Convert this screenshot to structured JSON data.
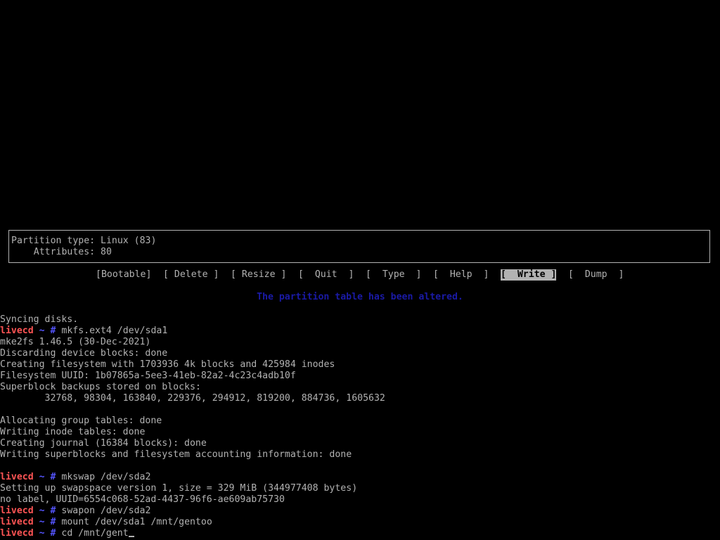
{
  "info": {
    "partition_type": "Partition type: Linux (83)",
    "attributes": "    Attributes: 80"
  },
  "menu": {
    "bootable": "[Bootable]",
    "delete": "[ Delete ]",
    "resize": "[ Resize ]",
    "quit": "[  Quit  ]",
    "type": "[  Type  ]",
    "help": "[  Help  ]",
    "write": "[  Write ]",
    "dump": "[  Dump  ]",
    "selected": "write"
  },
  "status_message": "The partition table has been altered.",
  "prompt": {
    "host": "livecd",
    "path": "~",
    "symbol": "#"
  },
  "terminal": {
    "line_00": "Syncing disks.",
    "cmd_01": "mkfs.ext4 /dev/sda1",
    "line_02": "mke2fs 1.46.5 (30-Dec-2021)",
    "line_03": "Discarding device blocks: done",
    "line_04": "Creating filesystem with 1703936 4k blocks and 425984 inodes",
    "line_05": "Filesystem UUID: 1b07865a-5ee3-41eb-82a2-4c23c4adb10f",
    "line_06": "Superblock backups stored on blocks:",
    "line_07": "        32768, 98304, 163840, 229376, 294912, 819200, 884736, 1605632",
    "line_09": "Allocating group tables: done",
    "line_10": "Writing inode tables: done",
    "line_11": "Creating journal (16384 blocks): done",
    "line_12": "Writing superblocks and filesystem accounting information: done",
    "cmd_14": "mkswap /dev/sda2",
    "line_15": "Setting up swapspace version 1, size = 329 MiB (344977408 bytes)",
    "line_16": "no label, UUID=6554c068-52ad-4437-96f6-ae609ab75730",
    "cmd_17": "swapon /dev/sda2",
    "cmd_18": "mount /dev/sda1 /mnt/gentoo",
    "cmd_19": "cd /mnt/gent"
  },
  "colors": {
    "background": "#000000",
    "foreground": "#b2b2b2",
    "prompt_host": "#ff5555",
    "prompt_tilde": "#5555ff",
    "status_message": "#1a1aa6"
  }
}
